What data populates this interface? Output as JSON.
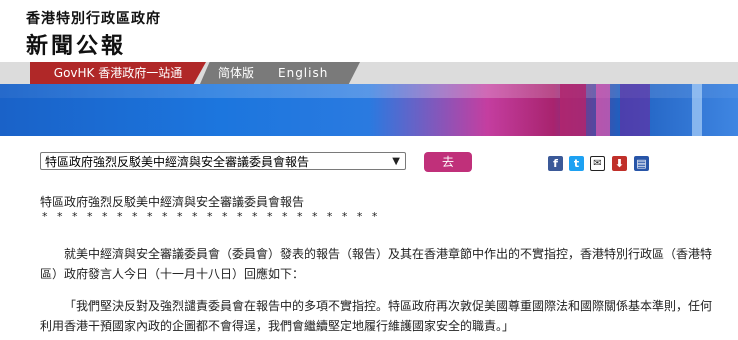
{
  "header": {
    "gov_name": "香港特別行政區政府",
    "paper_name": "新聞公報"
  },
  "nav": {
    "govhk_link": "GovHK 香港政府一站通",
    "simplified_link": "简体版",
    "english_link": "English"
  },
  "toolbar": {
    "select_value": "特區政府強烈反駁美中經濟與安全審議委員會報告",
    "go_label": "去",
    "share_icons": {
      "facebook": "facebook-icon",
      "twitter": "twitter-icon",
      "email": "email-icon",
      "save": "save-icon",
      "print": "print-icon"
    }
  },
  "article": {
    "title": "特區政府強烈反駁美中經濟與安全審議委員會報告",
    "separator": "* * * * * * * * * * * * * * * * * * * * * * *",
    "paragraphs": [
      "就美中經濟與安全審議委員會（委員會）發表的報告（報告）及其在香港章節中作出的不實指控，香港特別行政區（香港特區）政府發言人今日（十一月十八日）回應如下：",
      "「我們堅決反對及強烈譴責委員會在報告中的多項不實指控。特區政府再次敦促美國尊重國際法和國際關係基本準則，任何利用香港干預國家內政的企圖都不會得逞，我們會繼續堅定地履行維護國家安全的職責。」"
    ]
  },
  "colors": {
    "govhk_tab": "#b02828",
    "go_button": "#c0307a"
  }
}
